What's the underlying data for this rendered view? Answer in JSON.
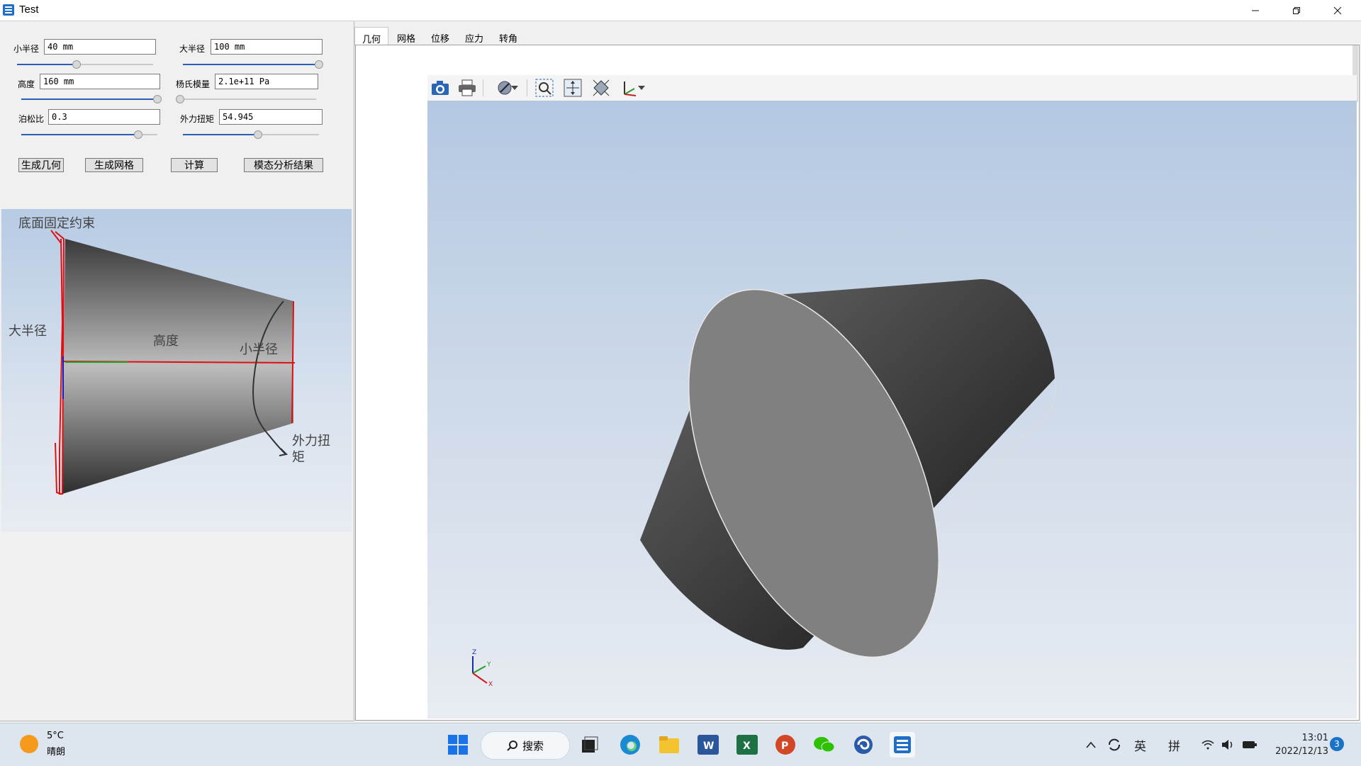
{
  "window": {
    "title": "Test",
    "minimize_icon": "minimize-icon",
    "restore_icon": "restore-icon",
    "close_icon": "close-icon"
  },
  "params": {
    "small_radius": {
      "label": "小半径",
      "value": "40 mm",
      "slider_fraction": 0.44
    },
    "large_radius": {
      "label": "大半径",
      "value": "100 mm",
      "slider_fraction": 1.0
    },
    "height": {
      "label": "高度",
      "value": "160 mm",
      "slider_fraction": 1.0
    },
    "youngs_modulus": {
      "label": "杨氏模量",
      "value": "2.1e+11 Pa",
      "slider_fraction": 0.0
    },
    "poisson_ratio": {
      "label": "泊松比",
      "value": "0.3",
      "slider_fraction": 0.86
    },
    "torque": {
      "label": "外力扭矩",
      "value": "54.945",
      "slider_fraction": 0.55
    }
  },
  "actions": {
    "generate_geometry": "生成几何",
    "generate_mesh": "生成网格",
    "compute": "计算",
    "modal_results": "模态分析结果"
  },
  "diagram": {
    "fixed_constraint": "底面固定约束",
    "large_radius": "大半径",
    "height": "高度",
    "small_radius": "小半径",
    "torque_line1": "外力扭",
    "torque_line2": "矩"
  },
  "tabs": [
    "几何",
    "网格",
    "位移",
    "应力",
    "转角"
  ],
  "active_tab": 0,
  "toolbar_icons": [
    "camera-icon",
    "print-icon",
    "hide-icon",
    "dropdown-icon",
    "zoom-box-icon",
    "pan-icon",
    "fit-icon",
    "axes-icon",
    "dropdown-icon"
  ],
  "axes_triad": {
    "z": "Z",
    "y": "Y",
    "x": "X"
  },
  "taskbar": {
    "weather_temp": "5°C",
    "weather_desc": "晴朗",
    "search_label": "搜索",
    "ime_lang": "英",
    "ime_mode": "拼",
    "time": "13:01",
    "date": "2022/12/13",
    "notification_count": "3",
    "colors": {
      "start": "#1a73e8",
      "word": "#2b579a",
      "excel": "#1e7145",
      "ppt": "#d24726",
      "wechat": "#2dc100"
    }
  }
}
